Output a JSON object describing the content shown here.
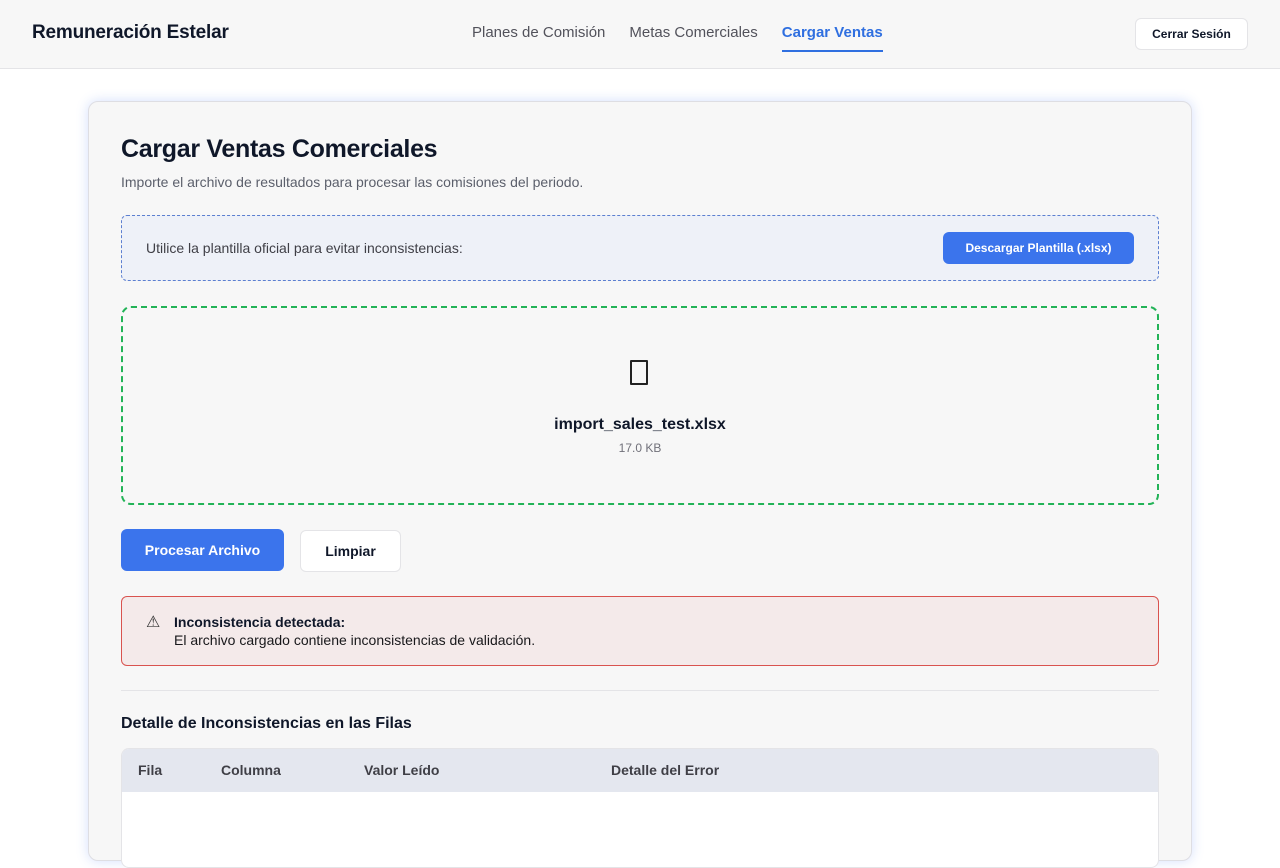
{
  "header": {
    "brand": "Remuneración Estelar",
    "nav": [
      {
        "label": "Planes de Comisión",
        "active": false
      },
      {
        "label": "Metas Comerciales",
        "active": false
      },
      {
        "label": "Cargar Ventas",
        "active": true
      }
    ],
    "logout_label": "Cerrar Sesión"
  },
  "main": {
    "title": "Cargar Ventas Comerciales",
    "subtitle": "Importe el archivo de resultados para procesar las comisiones del periodo.",
    "template": {
      "text": "Utilice la plantilla oficial para evitar inconsistencias:",
      "button_label": "Descargar Plantilla (.xlsx)"
    },
    "dropzone": {
      "icon": "file-icon",
      "file_name": "import_sales_test.xlsx",
      "file_size": "17.0 KB"
    },
    "actions": {
      "process_label": "Procesar Archivo",
      "clear_label": "Limpiar"
    },
    "alert": {
      "icon": "⚠",
      "title": "Inconsistencia detectada:",
      "message": "El archivo cargado contiene inconsistencias de validación."
    },
    "errors_section": {
      "title": "Detalle de Inconsistencias en las Filas",
      "columns": [
        "Fila",
        "Columna",
        "Valor Leído",
        "Detalle del Error"
      ]
    }
  },
  "colors": {
    "accent": "#3b74ec",
    "success_border": "#22b357",
    "error_border": "#d9534f"
  }
}
